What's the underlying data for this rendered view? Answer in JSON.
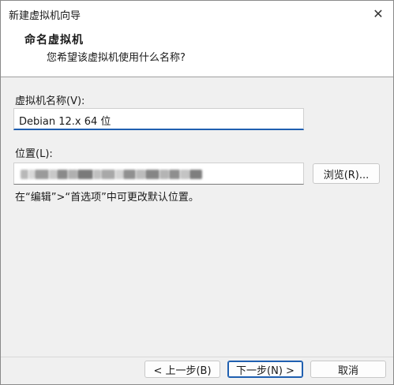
{
  "window": {
    "title": "新建虚拟机向导",
    "close_glyph": "✕"
  },
  "header": {
    "heading": "命名虚拟机",
    "subheading": "您希望该虚拟机使用什么名称?"
  },
  "form": {
    "name_label": "虚拟机名称(V):",
    "name_value": "Debian 12.x 64 位",
    "location_label": "位置(L):",
    "browse_label": "浏览(R)...",
    "hint": "在“编辑”>“首选项”中可更改默认位置。"
  },
  "footer": {
    "back_label": "< 上一步(B)",
    "next_label": "下一步(N) >",
    "cancel_label": "取消"
  },
  "colors": {
    "accent": "#1f5fb0",
    "window_bg": "#f0f0f0",
    "header_bg": "#ffffff"
  }
}
